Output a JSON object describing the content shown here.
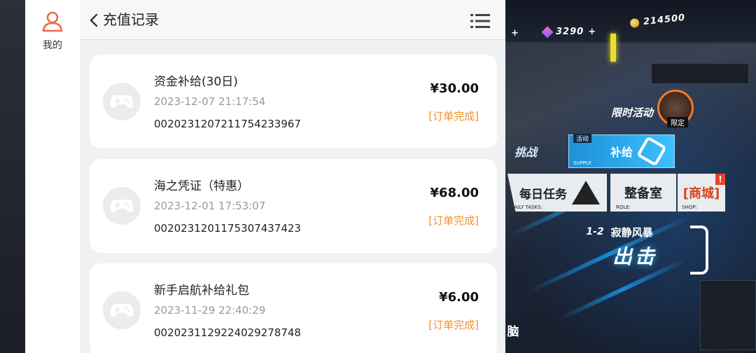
{
  "sidebar": {
    "mine_label": "我的"
  },
  "header": {
    "title": "充值记录"
  },
  "records": [
    {
      "name": "资金补给(30日)",
      "time": "2023-12-07 21:17:54",
      "order_no": "0020231207211754233967",
      "price": "¥30.00",
      "status": "[订单完成]"
    },
    {
      "name": "海之凭证（特惠）",
      "time": "2023-12-01 17:53:07",
      "order_no": "0020231201175307437423",
      "price": "¥68.00",
      "status": "[订单完成]"
    },
    {
      "name": "新手启航补给礼包",
      "time": "2023-11-29 22:40:29",
      "order_no": "0020231129224029278748",
      "price": "¥6.00",
      "status": "[订单完成]"
    }
  ],
  "game": {
    "res_left_plus": "+",
    "gems": "3290",
    "gems_plus": "+",
    "coins": "214500",
    "limited_event": "限时活动",
    "limited_tag": "限定",
    "supply_tag": "活动",
    "supply": "补给",
    "supply_sub": "SUPPLY:",
    "battle": "挑战",
    "daily": "每日任务",
    "daily_sub": "DAILY TASKS:",
    "prep": "整备室",
    "prep_sub": "ROLE:",
    "shop": "[商城]",
    "shop_sub": "SHOP:",
    "shop_alert": "!",
    "stage_num": "1-2",
    "stage_name": "寂静风暴",
    "sortie": "出击",
    "brain": "脑"
  },
  "colors": {
    "accent_orange": "#f0922a",
    "avatar_orange": "#ee6a45",
    "card_bg": "#ffffff",
    "list_bg": "#f0f1f3"
  }
}
